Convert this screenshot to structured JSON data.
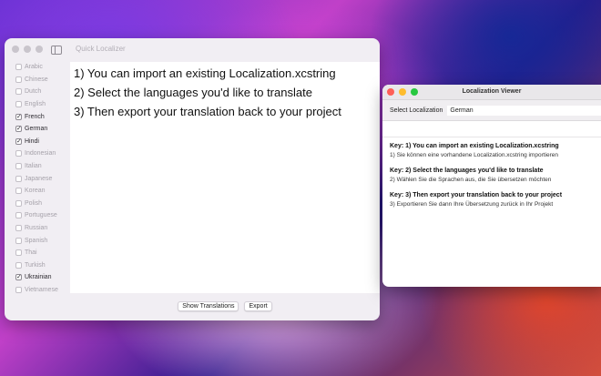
{
  "main_window": {
    "title": "Quick Localizer",
    "languages": [
      {
        "name": "Arabic",
        "checked": false
      },
      {
        "name": "Chinese",
        "checked": false
      },
      {
        "name": "Dutch",
        "checked": false
      },
      {
        "name": "English",
        "checked": false
      },
      {
        "name": "French",
        "checked": true
      },
      {
        "name": "German",
        "checked": true
      },
      {
        "name": "Hindi",
        "checked": true
      },
      {
        "name": "Indonesian",
        "checked": false
      },
      {
        "name": "Italian",
        "checked": false
      },
      {
        "name": "Japanese",
        "checked": false
      },
      {
        "name": "Korean",
        "checked": false
      },
      {
        "name": "Polish",
        "checked": false
      },
      {
        "name": "Portuguese",
        "checked": false
      },
      {
        "name": "Russian",
        "checked": false
      },
      {
        "name": "Spanish",
        "checked": false
      },
      {
        "name": "Thai",
        "checked": false
      },
      {
        "name": "Turkish",
        "checked": false
      },
      {
        "name": "Ukrainian",
        "checked": true
      },
      {
        "name": "Vietnamese",
        "checked": false
      }
    ],
    "editor_lines": [
      "1) You can import an existing Localization.xcstring",
      "2) Select the languages you'd like to translate",
      "3) Then export your translation back to your project"
    ],
    "show_translations_label": "Show Translations",
    "export_label": "Export"
  },
  "viewer_window": {
    "title": "Localization Viewer",
    "select_label": "Select Localization",
    "selected_value": "German",
    "entries": [
      {
        "key": "Key: 1) You can import an existing Localization.xcstring",
        "value": "1) Sie können eine vorhandene Localization.xcstring importieren"
      },
      {
        "key": "Key: 2) Select the languages you'd like to translate",
        "value": "2) Wählen Sie die Sprachen aus, die Sie übersetzen möchten"
      },
      {
        "key": "Key: 3) Then export your translation back to your project",
        "value": "3) Exportieren Sie dann Ihre Übersetzung zurück in Ihr Projekt"
      }
    ]
  },
  "colors": {
    "close": "#fe5f57",
    "minimize": "#febc2e",
    "zoom": "#28c840"
  }
}
